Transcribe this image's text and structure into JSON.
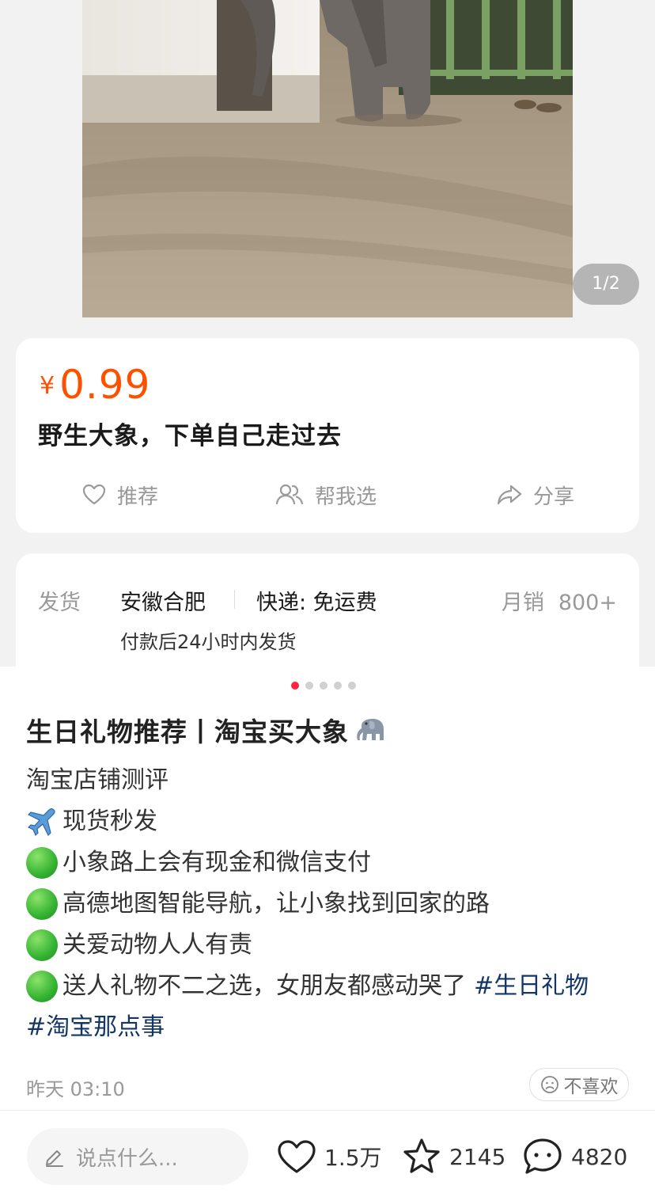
{
  "product": {
    "page_indicator": "1/2",
    "price_symbol": "¥",
    "price": "0.99",
    "title": "野生大象，下单自己走过去",
    "actions": {
      "recommend": "推荐",
      "help_choose": "帮我选",
      "share": "分享"
    },
    "shipping": {
      "label": "发货",
      "origin": "安徽合肥",
      "express": "快递: 免运费",
      "sales_label": "月销",
      "sales_value": "800+",
      "dispatch_time": "付款后24小时内发货"
    }
  },
  "note": {
    "carousel_total": 5,
    "carousel_active": 1,
    "title": "生日礼物推荐丨淘宝买大象",
    "title_icon": "elephant-emoji",
    "lines": [
      {
        "icon": "none",
        "text": "淘宝店铺测评"
      },
      {
        "icon": "airplane-emoji",
        "text": "现货秒发"
      },
      {
        "icon": "green-circle-emoji",
        "text": "小象路上会有现金和微信支付"
      },
      {
        "icon": "green-circle-emoji",
        "text": "高德地图智能导航，让小象找到回家的路"
      },
      {
        "icon": "green-circle-emoji",
        "text": "关爱动物人人有责"
      },
      {
        "icon": "green-circle-emoji",
        "text": "送人礼物不二之选，女朋友都感动哭了"
      }
    ],
    "hashtags": [
      "#生日礼物",
      "#淘宝那点事"
    ],
    "timestamp": "昨天 03:10",
    "dislike_label": "不喜欢"
  },
  "bottom_bar": {
    "comment_placeholder": "说点什么...",
    "likes": "1.5万",
    "collects": "2145",
    "comments": "4820"
  },
  "colors": {
    "price": "#ff5000",
    "hashtag": "#133667",
    "active_dot": "#ff2442"
  }
}
